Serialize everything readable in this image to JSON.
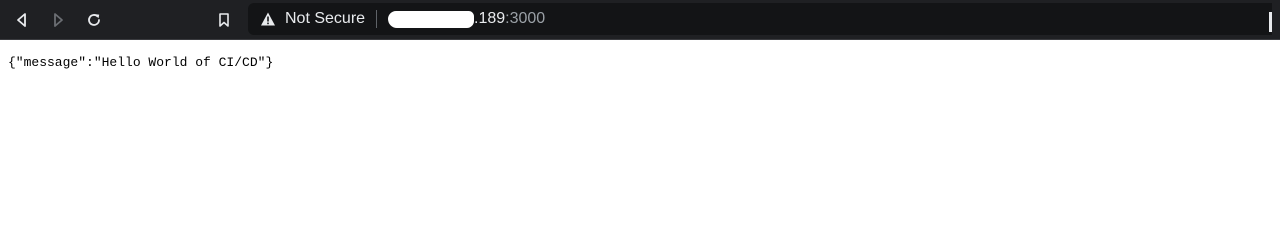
{
  "browser": {
    "icons": {
      "back": "back-arrow-icon",
      "forward": "forward-arrow-icon",
      "reload": "reload-icon",
      "bookmark": "bookmark-icon",
      "security": "warning-triangle-icon"
    },
    "security_label": "Not Secure",
    "address": {
      "host_suffix": ".189",
      "port": ":3000"
    },
    "colors": {
      "toolbar_bg": "#1f2023",
      "omnibox_bg": "#131416",
      "text": "#e8eaed",
      "muted": "#9aa0a6"
    }
  },
  "page": {
    "body_text": "{\"message\":\"Hello World of CI/CD\"}"
  }
}
